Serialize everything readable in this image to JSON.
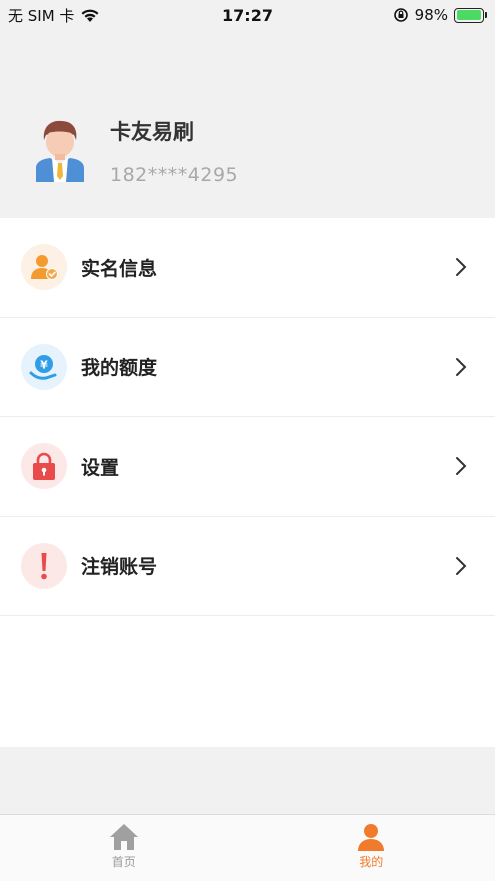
{
  "status_bar": {
    "carrier": "无 SIM 卡",
    "time": "17:27",
    "battery_percent": "98%",
    "battery_level": 0.98
  },
  "profile": {
    "name": "卡友易刷",
    "phone": "182****4295"
  },
  "menu": {
    "items": [
      {
        "label": "实名信息",
        "icon": "verified-user-icon"
      },
      {
        "label": "我的额度",
        "icon": "credit-limit-icon"
      },
      {
        "label": "设置",
        "icon": "lock-icon"
      },
      {
        "label": "注销账号",
        "icon": "exclamation-icon"
      }
    ]
  },
  "tabbar": {
    "tabs": [
      {
        "label": "首页",
        "icon": "home-icon",
        "active": false
      },
      {
        "label": "我的",
        "icon": "person-icon",
        "active": true
      }
    ]
  },
  "colors": {
    "accent": "#f07b2c",
    "inactive": "#9a9a9a",
    "battery": "#4cd964"
  }
}
